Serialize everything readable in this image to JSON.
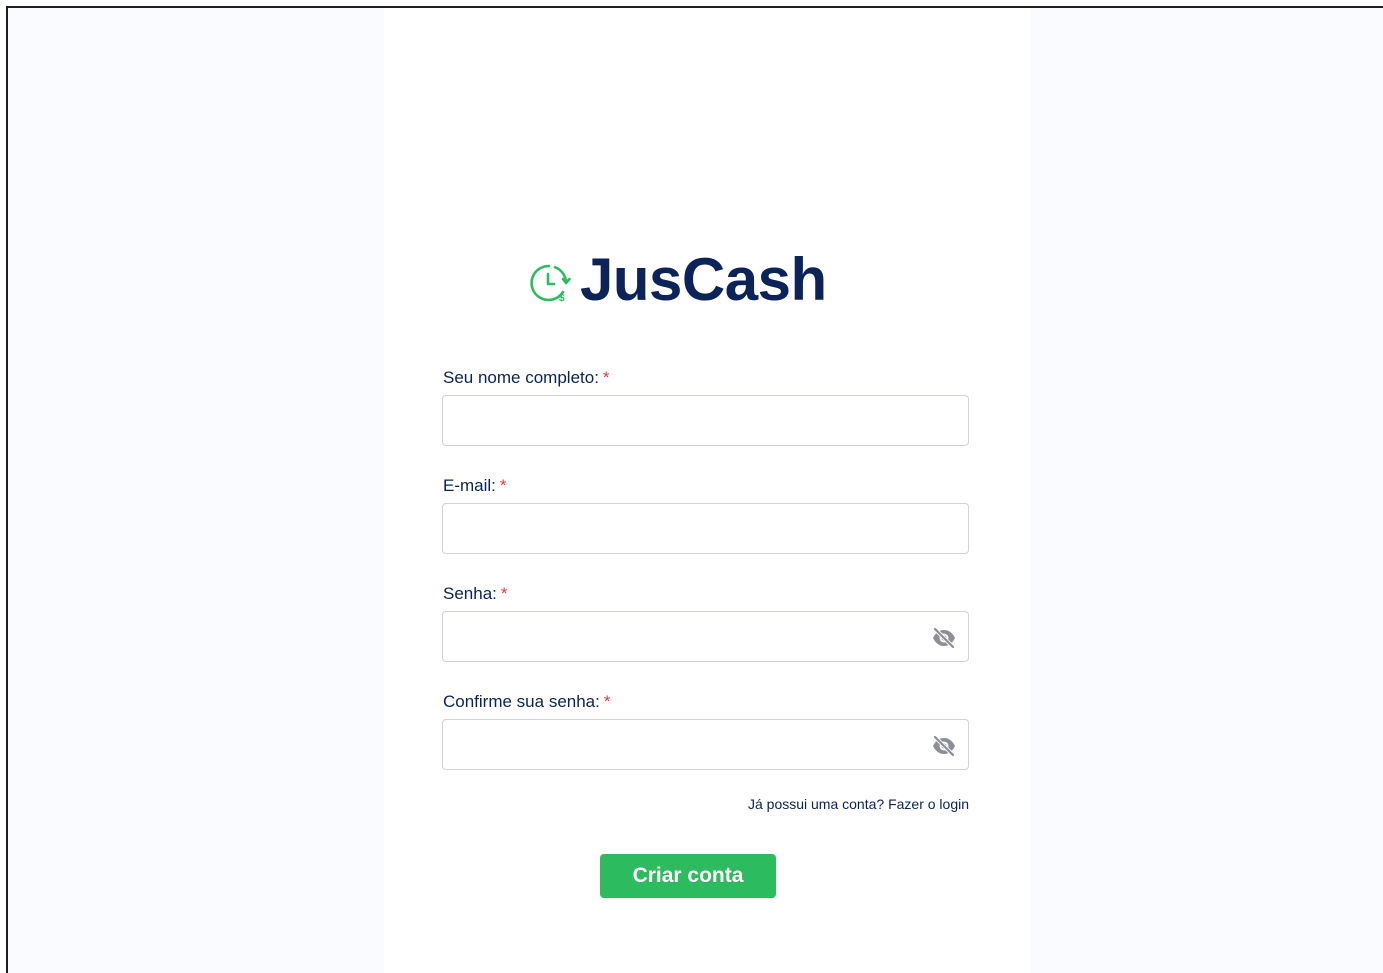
{
  "brand": {
    "name": "JusCash",
    "icon": "clock-dollar-icon",
    "accent_color": "#2cbc5f",
    "text_color": "#0b2358"
  },
  "form": {
    "fields": [
      {
        "label": "Seu nome completo:",
        "required_mark": "*",
        "value": "",
        "type": "text"
      },
      {
        "label": "E-mail:",
        "required_mark": "*",
        "value": "",
        "type": "email"
      },
      {
        "label": "Senha:",
        "required_mark": "*",
        "value": "",
        "type": "password",
        "icon": "eye-off-icon"
      },
      {
        "label": "Confirme sua senha:",
        "required_mark": "*",
        "value": "",
        "type": "password",
        "icon": "eye-off-icon"
      }
    ],
    "login_link": "Já possui uma conta? Fazer o login",
    "submit_label": "Criar conta"
  },
  "colors": {
    "required": "#e53935",
    "button": "#2cbc5f",
    "border": "#cfd3da"
  }
}
